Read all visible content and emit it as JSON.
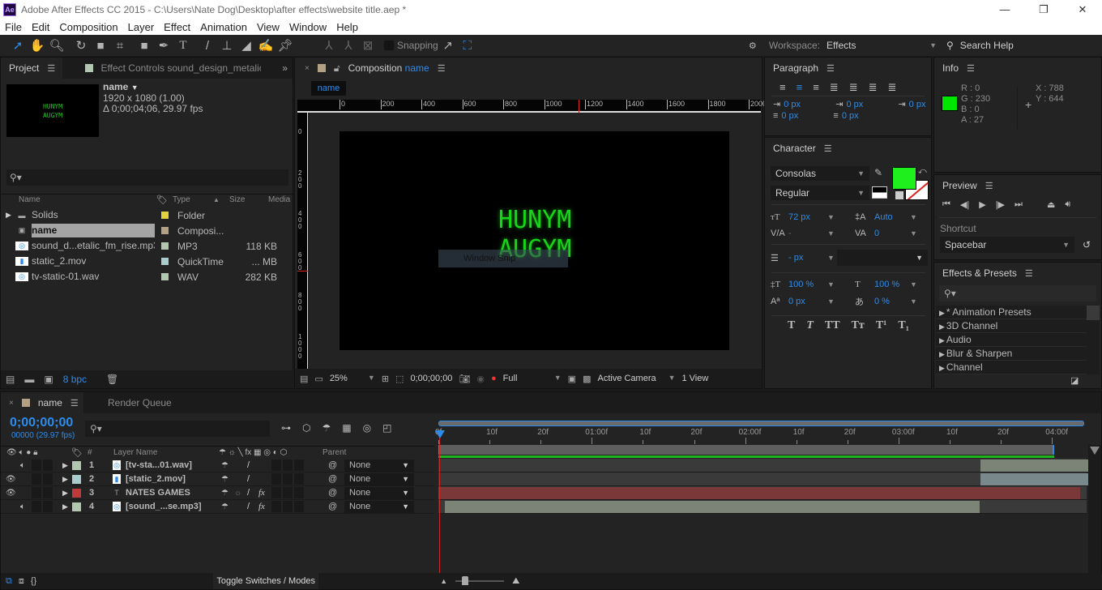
{
  "window": {
    "logo": "Ae",
    "title": "Adobe After Effects CC 2015 - C:\\Users\\Nate Dog\\Desktop\\after effects\\website title.aep *",
    "controls": [
      "—",
      "❐",
      "✕"
    ]
  },
  "menu": [
    "File",
    "Edit",
    "Composition",
    "Layer",
    "Effect",
    "Animation",
    "View",
    "Window",
    "Help"
  ],
  "toolbar": {
    "snapping_label": "Snapping",
    "workspace_label": "Workspace:",
    "workspace_value": "Effects",
    "search_placeholder": "Search Help"
  },
  "project": {
    "tab_project": "Project",
    "tab_effect_controls": "Effect Controls sound_design_metalic_",
    "comp_name": "name",
    "comp_size": "1920 x 1080 (1.00)",
    "comp_duration": "Δ 0;00;04;06, 29.97 fps",
    "thumb_line1": "HUNYM",
    "thumb_line2": "AUGYM",
    "columns": {
      "name": "Name",
      "type": "Type",
      "size": "Size",
      "media": "Media"
    },
    "items": [
      {
        "name": "Solids",
        "type": "Folder",
        "size": "",
        "label": "#e3d23f",
        "kind": "folder"
      },
      {
        "name": "name",
        "type": "Composi...",
        "size": "",
        "label": "#b2a283",
        "kind": "comp"
      },
      {
        "name": "sound_d...etalic_fm_rise.mp3",
        "type": "MP3",
        "size": "118 KB",
        "label": "#b1c7b0",
        "kind": "audio"
      },
      {
        "name": "static_2.mov",
        "type": "QuickTime",
        "size": "... MB",
        "label": "#a9cccc",
        "kind": "video"
      },
      {
        "name": "tv-static-01.wav",
        "type": "WAV",
        "size": "282 KB",
        "label": "#b1c7b0",
        "kind": "audio"
      }
    ],
    "bpc": "8 bpc"
  },
  "composition": {
    "tab_label": "Composition",
    "tab_comp_name": "name",
    "flow_tab": "name",
    "ruler_h": [
      "0",
      "200",
      "400",
      "600",
      "800",
      "1000",
      "1200",
      "1400",
      "1600",
      "1800",
      "2000"
    ],
    "ruler_v": [
      "0",
      "200",
      "400",
      "600",
      "800",
      "1000"
    ],
    "text_line1": "HUNYM",
    "text_line2": "AUGYM",
    "snip_tooltip": "Window Snip",
    "zoom": "25%",
    "timecode": "0;00;00;00",
    "resolution": "Full",
    "camera": "Active Camera",
    "views": "1 View"
  },
  "paragraph": {
    "title": "Paragraph",
    "indent_left": "0 px",
    "indent_right": "0 px",
    "indent_first": "0 px",
    "space_before": "0 px",
    "space_after": "0 px"
  },
  "info": {
    "title": "Info",
    "r": "R : 0",
    "g": "G : 230",
    "b": "B : 0",
    "a": "A : 27",
    "x": "X : 788",
    "y": "Y : 644",
    "swatch": "#00e600"
  },
  "character": {
    "title": "Character",
    "font": "Consolas",
    "style": "Regular",
    "fill_color": "#1ef01e",
    "font_size": "72 px",
    "leading": "Auto",
    "kerning": "-",
    "tracking": "0",
    "stroke_width": "- px",
    "vscale": "100 %",
    "hscale": "100 %",
    "baseline": "0 px",
    "tsume": "0 %",
    "styles": [
      "T",
      "T",
      "TT",
      "Tт",
      "T¹",
      "T₁"
    ]
  },
  "preview": {
    "title": "Preview",
    "shortcut_label": "Shortcut",
    "shortcut_value": "Spacebar"
  },
  "effects": {
    "title": "Effects & Presets",
    "items": [
      "* Animation Presets",
      "3D Channel",
      "Audio",
      "Blur & Sharpen",
      "Channel"
    ]
  },
  "timeline": {
    "tab_comp": "name",
    "tab_render": "Render Queue",
    "timecode": "0;00;00;00",
    "frame_info": "00000 (29.97 fps)",
    "col_layer_name": "Layer Name",
    "col_num": "#",
    "col_parent": "Parent",
    "ruler": [
      "0f",
      "10f",
      "20f",
      "01:00f",
      "10f",
      "20f",
      "02:00f",
      "10f",
      "20f",
      "03:00f",
      "10f",
      "20f",
      "04:00f"
    ],
    "layers": [
      {
        "num": "1",
        "name": "[tv-sta...01.wav]",
        "label": "#b1c7b0",
        "kind": "audio",
        "eye": false,
        "audio": true,
        "fx": false,
        "parent": "None",
        "bar_color": "#7c8478",
        "bar_start": 0.88
      },
      {
        "num": "2",
        "name": "[static_2.mov]",
        "label": "#a9cccc",
        "kind": "video",
        "eye": true,
        "audio": false,
        "fx": false,
        "parent": "None",
        "bar_color": "#79888a",
        "bar_start": 0.88
      },
      {
        "num": "3",
        "name": "NATES GAMES",
        "label": "#c03a3a",
        "kind": "text",
        "eye": true,
        "audio": false,
        "fx": true,
        "parent": "None",
        "bar_color": "#7a3838",
        "bar_start": 0.0
      },
      {
        "num": "4",
        "name": "[sound_...se.mp3]",
        "label": "#b1c7b0",
        "kind": "audio",
        "eye": false,
        "audio": true,
        "fx": true,
        "parent": "None",
        "bar_color": "#7c8478",
        "bar_start": 0.0
      }
    ],
    "toggle_label": "Toggle Switches / Modes"
  }
}
